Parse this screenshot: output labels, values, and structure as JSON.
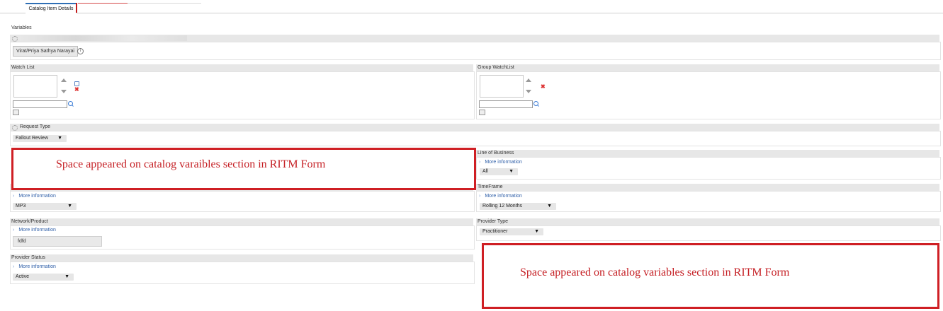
{
  "tabs": {
    "active": "Catalog Item Details"
  },
  "section": {
    "label": "Variables"
  },
  "requested_for": {
    "value": "Virat/Priya Sathya Narayai"
  },
  "watch_list": {
    "label": "Watch List"
  },
  "group_watch_list": {
    "label": "Group WatchList"
  },
  "request_type": {
    "label": "Request Type",
    "value": "Fallout Review"
  },
  "line_of_business": {
    "label": "Line of Business",
    "more_info": "More information",
    "value": "All"
  },
  "left_row": {
    "more_info": "More information",
    "value": "MP3"
  },
  "time_frame": {
    "label": "TimeFrame",
    "more_info": "More information",
    "value": "Rolling 12 Months"
  },
  "network_product": {
    "label": "Network/Product",
    "more_info": "More information",
    "value": "fdfd"
  },
  "provider_type": {
    "label": "Provider Type",
    "value": "Practitioner"
  },
  "provider_status": {
    "label": "Provider Status",
    "more_info": "More information",
    "value": "Active"
  },
  "annotations": {
    "first": "Space appeared on catalog varaibles section in RITM Form",
    "second": "Space appeared on catalog variables section in RITM Form"
  },
  "icons": {
    "info": "info-icon",
    "lock": "lock-icon",
    "remove": "x-icon",
    "search": "search-icon",
    "add": "add-row-icon",
    "caret": "caret-right-icon",
    "dropdown": "triangle-down-icon",
    "mandatory": "asterisk-icon"
  },
  "colors": {
    "annotation": "#cf1f24",
    "link": "#2f5fa8",
    "tab_accent": "#2f6fb5"
  }
}
